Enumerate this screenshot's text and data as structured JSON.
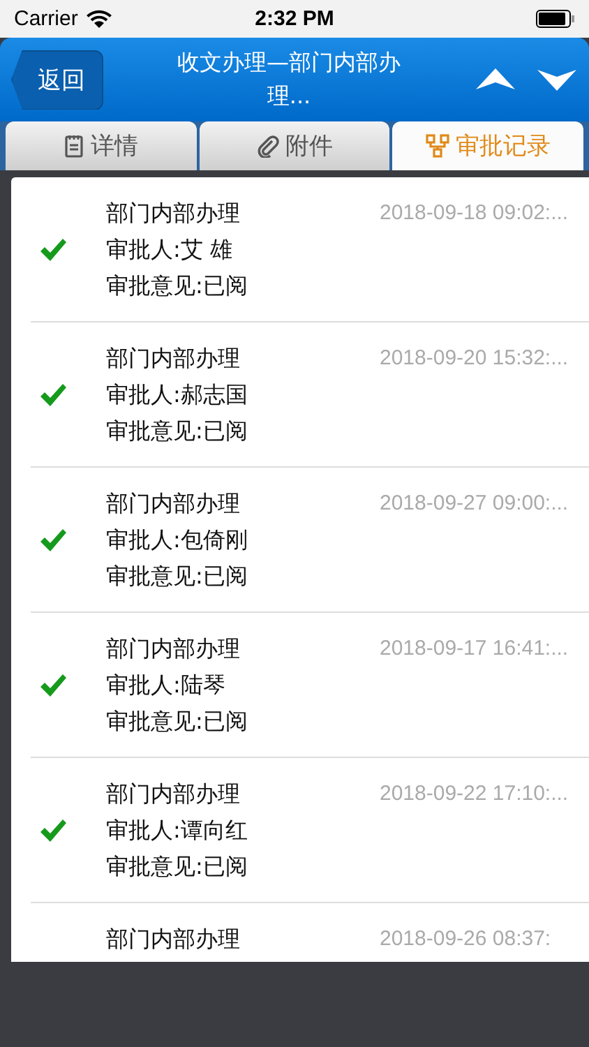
{
  "status_bar": {
    "carrier": "Carrier",
    "time": "2:32 PM"
  },
  "nav": {
    "back": "返回",
    "title": "收文办理—部门内部办理..."
  },
  "tabs": [
    {
      "label": "详情",
      "selected": false
    },
    {
      "label": "附件",
      "selected": false
    },
    {
      "label": "审批记录",
      "selected": true
    }
  ],
  "records": [
    {
      "step": "部门内部办理",
      "approver": "审批人:艾 雄",
      "opinion": "审批意见:已阅",
      "time": "2018-09-18 09:02:...",
      "checked": true
    },
    {
      "step": "部门内部办理",
      "approver": "审批人:郝志国",
      "opinion": "审批意见:已阅",
      "time": "2018-09-20 15:32:...",
      "checked": true
    },
    {
      "step": "部门内部办理",
      "approver": "审批人:包倚刚",
      "opinion": "审批意见:已阅",
      "time": "2018-09-27 09:00:...",
      "checked": true
    },
    {
      "step": "部门内部办理",
      "approver": "审批人:陆琴",
      "opinion": "审批意见:已阅",
      "time": "2018-09-17 16:41:...",
      "checked": true
    },
    {
      "step": "部门内部办理",
      "approver": "审批人:谭向红",
      "opinion": "审批意见:已阅",
      "time": "2018-09-22 17:10:...",
      "checked": true
    },
    {
      "step": "部门内部办理",
      "time": "2018-09-26 08:37:"
    }
  ]
}
